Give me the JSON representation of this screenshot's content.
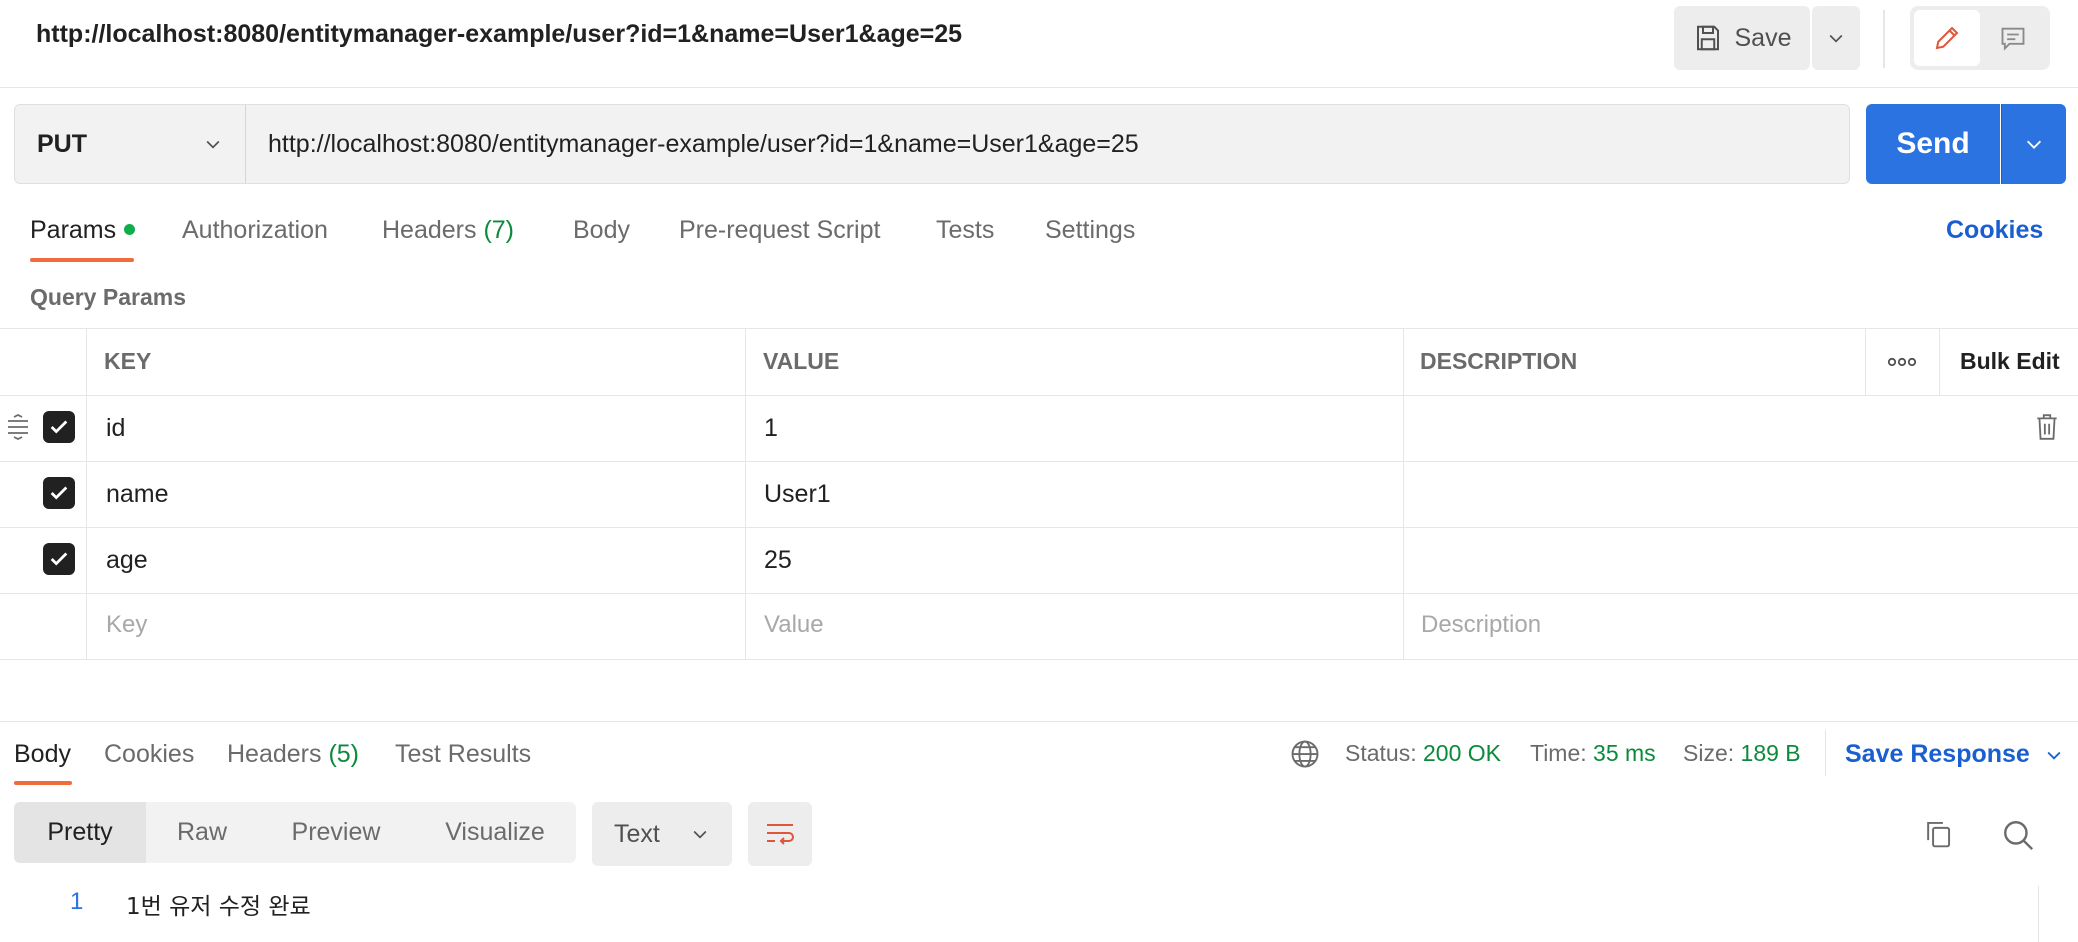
{
  "header": {
    "title": "http://localhost:8080/entitymanager-example/user?id=1&name=User1&age=25",
    "save_label": "Save"
  },
  "request": {
    "method": "PUT",
    "url": "http://localhost:8080/entitymanager-example/user?id=1&name=User1&age=25",
    "send_label": "Send"
  },
  "request_tabs": {
    "params": "Params",
    "authorization": "Authorization",
    "headers": "Headers",
    "headers_count": "(7)",
    "body": "Body",
    "prerequest": "Pre-request Script",
    "tests": "Tests",
    "settings": "Settings",
    "cookies": "Cookies"
  },
  "query_params": {
    "label": "Query Params",
    "columns": {
      "key": "KEY",
      "value": "VALUE",
      "description": "DESCRIPTION",
      "more": "ooo",
      "bulk_edit": "Bulk Edit"
    },
    "rows": [
      {
        "key": "id",
        "value": "1",
        "description": "",
        "checked": true
      },
      {
        "key": "name",
        "value": "User1",
        "description": "",
        "checked": true
      },
      {
        "key": "age",
        "value": "25",
        "description": "",
        "checked": true
      }
    ],
    "placeholders": {
      "key": "Key",
      "value": "Value",
      "description": "Description"
    }
  },
  "response": {
    "tabs": {
      "body": "Body",
      "cookies": "Cookies",
      "headers": "Headers",
      "headers_count": "(5)",
      "test_results": "Test Results"
    },
    "status_label": "Status:",
    "status_value": "200 OK",
    "time_label": "Time:",
    "time_value": "35 ms",
    "size_label": "Size:",
    "size_value": "189 B",
    "save_response": "Save Response",
    "view_modes": [
      "Pretty",
      "Raw",
      "Preview",
      "Visualize"
    ],
    "format": "Text",
    "lines": [
      {
        "number": "1",
        "text": "1번 유저 수정 완료"
      }
    ]
  },
  "colors": {
    "accent_blue": "#2b73e0",
    "tab_underline": "#f26b3a",
    "success_green": "#0b8a3c"
  }
}
